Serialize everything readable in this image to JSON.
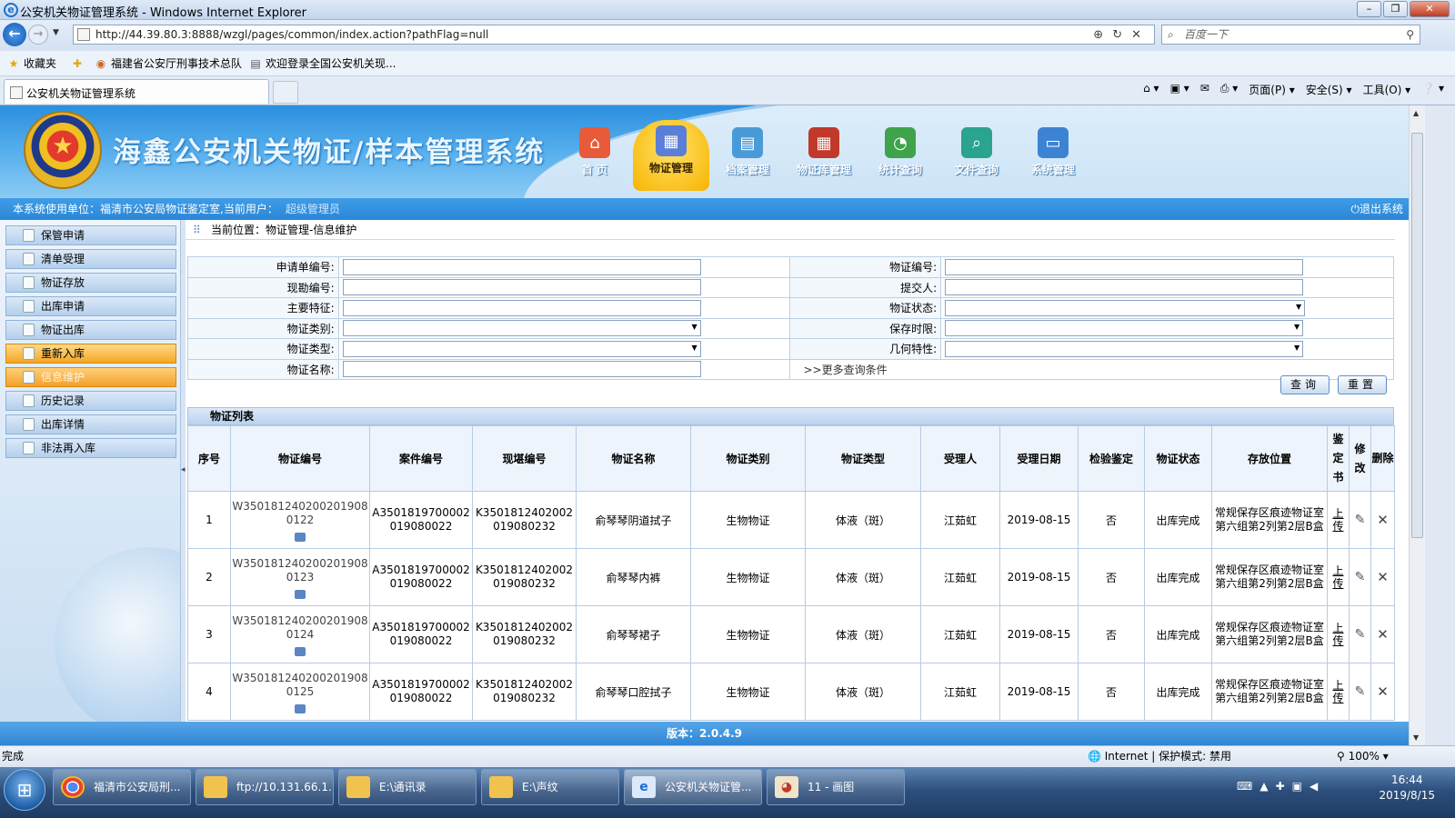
{
  "browser": {
    "window_title": "公安机关物证管理系统 - Windows Internet Explorer",
    "url": "http://44.39.80.3:8888/wzgl/pages/common/index.action?pathFlag=null",
    "search_placeholder": "百度一下",
    "favorites_label": "收藏夹",
    "favorites": [
      "福建省公安厅刑事技术总队",
      "欢迎登录全国公安机关现..."
    ],
    "tab_title": "公安机关物证管理系统",
    "commands": [
      "页面(P) ▾",
      "安全(S) ▾",
      "工具(O) ▾"
    ],
    "status_left": "完成",
    "status_zone": "Internet | 保护模式: 禁用",
    "zoom": "100%"
  },
  "app": {
    "title": "海鑫公安机关物证/样本管理系统",
    "nav": [
      {
        "label": "首  页",
        "icon": "home-icon"
      },
      {
        "label": "物证管理",
        "icon": "calendar-icon",
        "active": true
      },
      {
        "label": "档案管理",
        "icon": "document-icon"
      },
      {
        "label": "物证库管理",
        "icon": "grid-icon"
      },
      {
        "label": "统计查询",
        "icon": "chart-icon"
      },
      {
        "label": "文件查询",
        "icon": "search-doc-icon"
      },
      {
        "label": "系统管理",
        "icon": "monitor-icon"
      }
    ],
    "infobar_prefix": "本系统使用单位：福清市公安局物证鉴定室,当前用户：",
    "current_user": "超级管理员",
    "logout": "退出系统",
    "version": "版本：2.0.4.9"
  },
  "sidebar": {
    "items": [
      {
        "label": "保管申请"
      },
      {
        "label": "清单受理"
      },
      {
        "label": "物证存放"
      },
      {
        "label": "出库申请"
      },
      {
        "label": "物证出库"
      },
      {
        "label": "重新入库",
        "state": "hover"
      },
      {
        "label": "信息维护",
        "state": "selected"
      },
      {
        "label": "历史记录"
      },
      {
        "label": "出库详情"
      },
      {
        "label": "非法再入库"
      }
    ]
  },
  "breadcrumb": "当前位置：物证管理-信息维护",
  "query": {
    "apply_no": "申请单编号:",
    "evidence_no": "物证编号:",
    "survey_no": "现勘编号:",
    "submitter": "提交人:",
    "feature": "主要特征:",
    "status": "物证状态:",
    "category": "物证类别:",
    "retention": "保存时限:",
    "type": "物证类型:",
    "geometry": "几何特性:",
    "name": "物证名称:",
    "more": ">>更多查询条件",
    "search_button": "查询",
    "reset_button": "重置"
  },
  "list": {
    "title": "物证列表",
    "columns": [
      "序号",
      "物证编号",
      "案件编号",
      "现堪编号",
      "物证名称",
      "物证类别",
      "物证类型",
      "受理人",
      "受理日期",
      "检验鉴定",
      "物证状态",
      "存放位置",
      "鉴定书",
      "修改",
      "删除"
    ],
    "upload_label": "上传",
    "rows": [
      {
        "no": "1",
        "code": "W3501812402002019080122",
        "case": "A3501819700002019080022",
        "survey": "K3501812402002019080232",
        "name": "俞琴琴阴道拭子",
        "category": "生物物证",
        "type": "体液（斑）",
        "handler": "江茹虹",
        "date": "2019-08-15",
        "inspect": "否",
        "status": "出库完成",
        "location": "常规保存区痕迹物证室第六组第2列第2层B盒"
      },
      {
        "no": "2",
        "code": "W3501812402002019080123",
        "case": "A3501819700002019080022",
        "survey": "K3501812402002019080232",
        "name": "俞琴琴内裤",
        "category": "生物物证",
        "type": "体液（斑）",
        "handler": "江茹虹",
        "date": "2019-08-15",
        "inspect": "否",
        "status": "出库完成",
        "location": "常规保存区痕迹物证室第六组第2列第2层B盒"
      },
      {
        "no": "3",
        "code": "W3501812402002019080124",
        "case": "A3501819700002019080022",
        "survey": "K3501812402002019080232",
        "name": "俞琴琴裙子",
        "category": "生物物证",
        "type": "体液（斑）",
        "handler": "江茹虹",
        "date": "2019-08-15",
        "inspect": "否",
        "status": "出库完成",
        "location": "常规保存区痕迹物证室第六组第2列第2层B盒"
      },
      {
        "no": "4",
        "code": "W3501812402002019080125",
        "case": "A3501819700002019080022",
        "survey": "K3501812402002019080232",
        "name": "俞琴琴口腔拭子",
        "category": "生物物证",
        "type": "体液（斑）",
        "handler": "江茹虹",
        "date": "2019-08-15",
        "inspect": "否",
        "status": "出库完成",
        "location": "常规保存区痕迹物证室第六组第2列第2层B盒"
      }
    ]
  },
  "taskbar": {
    "items": [
      {
        "label": "福清市公安局刑...",
        "icon": "chrome-icon"
      },
      {
        "label": "ftp://10.131.66.1...",
        "icon": "folder-icon"
      },
      {
        "label": "E:\\通讯录",
        "icon": "folder-icon"
      },
      {
        "label": "E:\\声纹",
        "icon": "folder-icon"
      },
      {
        "label": "公安机关物证管...",
        "icon": "ie-icon",
        "active": true
      },
      {
        "label": "11 - 画图",
        "icon": "paint-icon"
      }
    ],
    "time": "16:44",
    "date": "2019/8/15"
  }
}
